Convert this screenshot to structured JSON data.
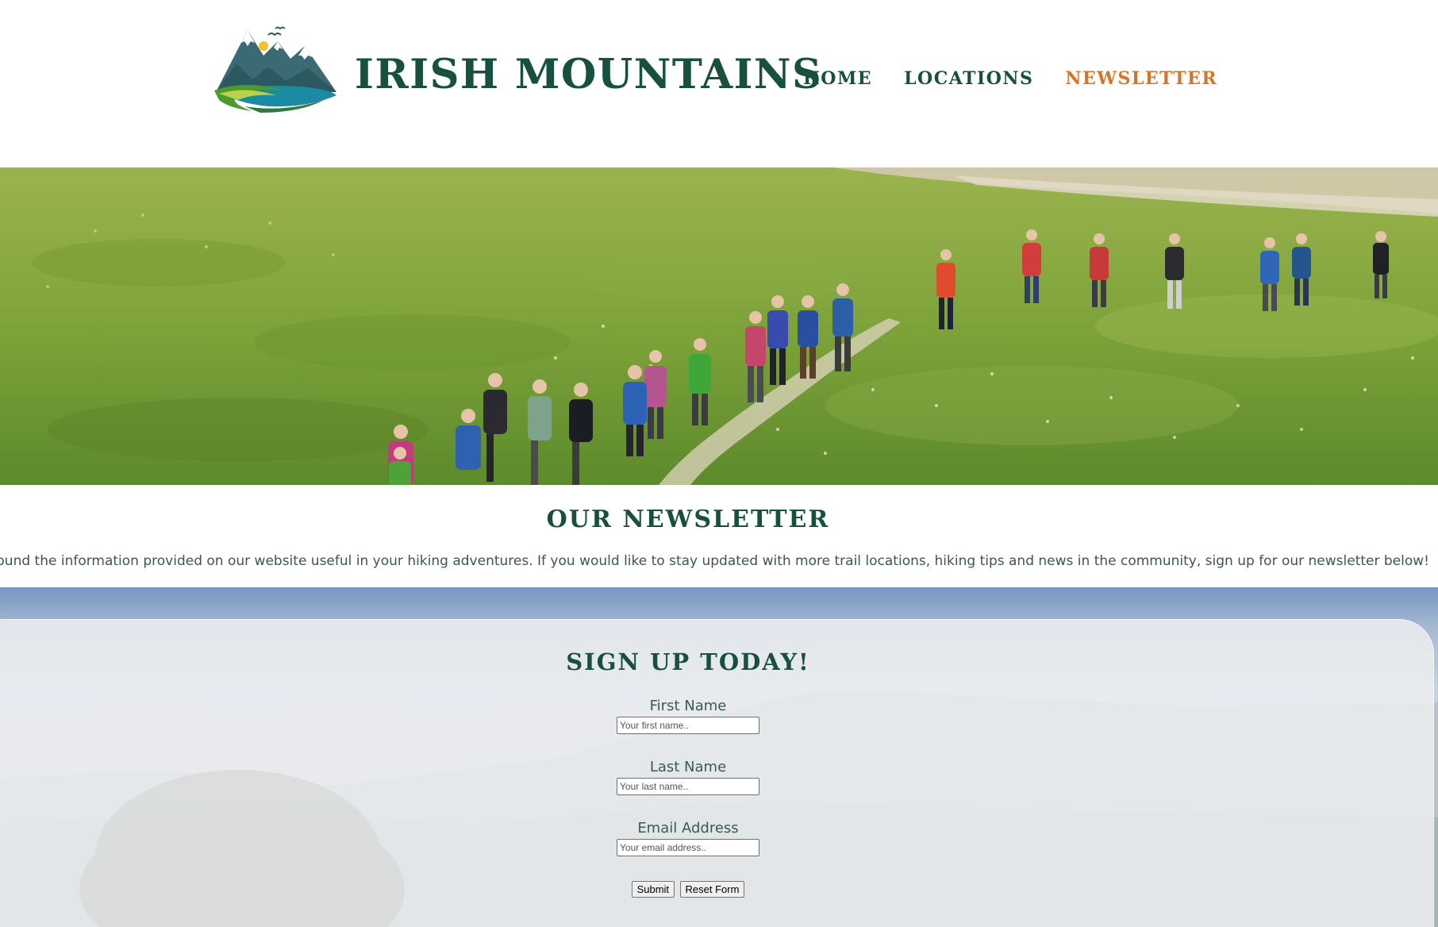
{
  "header": {
    "brand": "IRISH MOUNTAINS",
    "nav": [
      {
        "label": "HOME",
        "active": false
      },
      {
        "label": "LOCATIONS",
        "active": false
      },
      {
        "label": "NEWSLETTER",
        "active": true
      }
    ],
    "nav_active_color": "#d6752a",
    "brand_color": "#18503f"
  },
  "intro": {
    "title": "OUR NEWSLETTER",
    "text": "e you found the information provided on our website useful in your hiking adventures. If you would like to stay updated with more trail locations, hiking tips and news in the community, sign up for our newsletter below!"
  },
  "signup": {
    "title": "SIGN UP TODAY!",
    "fields": [
      {
        "label": "First Name",
        "placeholder": "Your first name.."
      },
      {
        "label": "Last Name",
        "placeholder": "Your last name.."
      },
      {
        "label": "Email Address",
        "placeholder": "Your email address.."
      }
    ],
    "submit_label": "Submit",
    "reset_label": "Reset Form"
  },
  "icons": {
    "logo": "mountain-logo-icon"
  }
}
